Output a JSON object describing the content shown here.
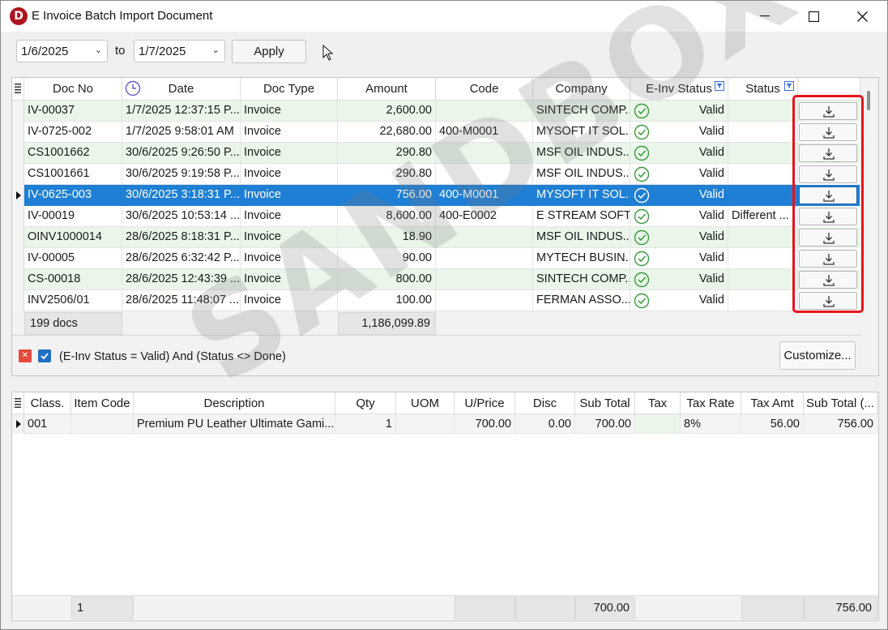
{
  "window": {
    "title": "E Invoice Batch Import Document",
    "logo_letter": "D"
  },
  "filter_bar": {
    "date_from": "1/6/2025",
    "to_label": "to",
    "date_to": "1/7/2025",
    "apply_label": "Apply"
  },
  "doc_grid": {
    "columns": [
      "Doc No",
      "Date",
      "Doc Type",
      "Amount",
      "Code",
      "Company",
      "E-Inv Status",
      "Status"
    ],
    "rows": [
      {
        "doc_no": "IV-00037",
        "date": "1/7/2025 12:37:15 P...",
        "doc_type": "Invoice",
        "amount": "2,600.00",
        "code": "",
        "company": "SINTECH COMP...",
        "einv_status": "Valid",
        "status": ""
      },
      {
        "doc_no": "IV-0725-002",
        "date": "1/7/2025 9:58:01 AM",
        "doc_type": "Invoice",
        "amount": "22,680.00",
        "code": "400-M0001",
        "company": "MYSOFT IT SOL...",
        "einv_status": "Valid",
        "status": ""
      },
      {
        "doc_no": "CS1001662",
        "date": "30/6/2025 9:26:50 P...",
        "doc_type": "Invoice",
        "amount": "290.80",
        "code": "",
        "company": "MSF OIL INDUS...",
        "einv_status": "Valid",
        "status": ""
      },
      {
        "doc_no": "CS1001661",
        "date": "30/6/2025 9:19:58 P...",
        "doc_type": "Invoice",
        "amount": "290.80",
        "code": "",
        "company": "MSF OIL INDUS...",
        "einv_status": "Valid",
        "status": ""
      },
      {
        "doc_no": "IV-0625-003",
        "date": "30/6/2025 3:18:31 P...",
        "doc_type": "Invoice",
        "amount": "756.00",
        "code": "400-M0001",
        "company": "MYSOFT IT SOL...",
        "einv_status": "Valid",
        "status": ""
      },
      {
        "doc_no": "IV-00019",
        "date": "30/6/2025 10:53:14 ...",
        "doc_type": "Invoice",
        "amount": "8,600.00",
        "code": "400-E0002",
        "company": "E STREAM SOFT...",
        "einv_status": "Valid",
        "status": "Different ..."
      },
      {
        "doc_no": "OINV1000014",
        "date": "28/6/2025 8:18:31 P...",
        "doc_type": "Invoice",
        "amount": "18.90",
        "code": "",
        "company": "MSF OIL INDUS...",
        "einv_status": "Valid",
        "status": ""
      },
      {
        "doc_no": "IV-00005",
        "date": "28/6/2025 6:32:42 P...",
        "doc_type": "Invoice",
        "amount": "90.00",
        "code": "",
        "company": "MYTECH BUSIN...",
        "einv_status": "Valid",
        "status": ""
      },
      {
        "doc_no": "CS-00018",
        "date": "28/6/2025 12:43:39 ...",
        "doc_type": "Invoice",
        "amount": "800.00",
        "code": "",
        "company": "SINTECH COMP...",
        "einv_status": "Valid",
        "status": ""
      },
      {
        "doc_no": "INV2506/01",
        "date": "28/6/2025 11:48:07 ...",
        "doc_type": "Invoice",
        "amount": "100.00",
        "code": "",
        "company": "FERMAN ASSO...",
        "einv_status": "Valid",
        "status": ""
      }
    ],
    "selected_row": 4,
    "footer": {
      "count": "199 docs",
      "total_amount": "1,186,099.89"
    }
  },
  "filter": {
    "expression": "(E-Inv Status = Valid) And (Status <> Done)",
    "customize_label": "Customize..."
  },
  "detail_grid": {
    "columns": [
      "Class.",
      "Item Code",
      "Description",
      "Qty",
      "UOM",
      "U/Price",
      "Disc",
      "Sub Total",
      "Tax",
      "Tax Rate",
      "Tax Amt",
      "Sub Total (..."
    ],
    "row": {
      "class": "001",
      "item_code": "",
      "description": "Premium PU Leather Ultimate Gami...",
      "qty": "1",
      "uom": "",
      "uprice": "700.00",
      "disc": "0.00",
      "sub_total": "700.00",
      "tax": "",
      "tax_rate": "8%",
      "tax_amt": "56.00",
      "sub_total_incl": "756.00"
    },
    "footer": {
      "count": "1",
      "sub_total": "700.00",
      "sub_total_incl": "756.00"
    }
  },
  "watermark": "SANDBOX",
  "colors": {
    "row_alt": "#e9f6e9",
    "selected": "#1f7fd4",
    "highlight": "#e8131c",
    "valid_icon": "#3a9a3a"
  }
}
